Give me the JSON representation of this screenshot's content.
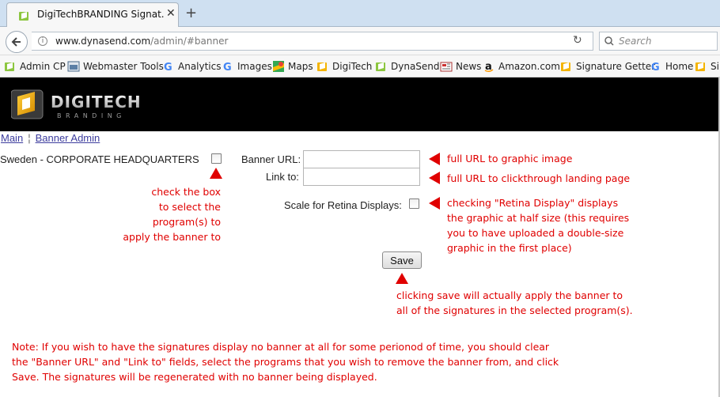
{
  "browser": {
    "tab_title": "DigiTechBRANDING Signat...",
    "url_host": "www.dynasend.com",
    "url_path": "/admin/#banner",
    "search_placeholder": "Search",
    "bookmarks": [
      {
        "label": "Admin CP",
        "icon": "digitech-icon"
      },
      {
        "label": "Webmaster Tools",
        "icon": "webmaster-icon"
      },
      {
        "label": "Analytics",
        "icon": "google-icon"
      },
      {
        "label": "Images",
        "icon": "google-icon"
      },
      {
        "label": "Maps",
        "icon": "maps-icon"
      },
      {
        "label": "DigiTech",
        "icon": "digitech-icon"
      },
      {
        "label": "DynaSend",
        "icon": "digitech-icon"
      },
      {
        "label": "News",
        "icon": "news-icon"
      },
      {
        "label": "Amazon.com",
        "icon": "amazon-icon"
      },
      {
        "label": "Signature Getter",
        "icon": "digitech-icon"
      },
      {
        "label": "Home",
        "icon": "google-icon"
      },
      {
        "label": "Si",
        "icon": "digitech-icon"
      }
    ]
  },
  "logo": {
    "word": "DIGITECH",
    "sub": "BRANDING"
  },
  "breadcrumb": {
    "main": "Main",
    "separator": "¦",
    "current": "Banner Admin"
  },
  "program": {
    "label": "Sweden - CORPORATE HEADQUARTERS"
  },
  "form": {
    "banner_url_label": "Banner URL:",
    "banner_url_value": "",
    "link_to_label": "Link to:",
    "link_to_value": "",
    "retina_label": "Scale for Retina Displays:",
    "save_label": "Save"
  },
  "annotations": {
    "checkbox_note": [
      "check the box",
      "to select the",
      "program(s) to",
      "apply the banner to"
    ],
    "banner_url_note": "full URL to graphic image",
    "link_to_note": "full URL to clickthrough landing page",
    "retina_note": [
      "checking \"Retina Display\" displays",
      "the graphic at half size (this requires",
      "you to have uploaded a double-size",
      "graphic in the first place)"
    ],
    "save_note": [
      "clicking save will actually apply the banner to",
      "all of the signatures in the selected program(s)."
    ],
    "footer_note": [
      "Note: If you wish to have the signatures display no banner at all for some perionod of time, you should clear",
      "the \"Banner URL\" and \"Link to\" fields, select the programs that you wish to remove the banner from, and click",
      "Save. The signatures will be regenerated with no banner being displayed."
    ]
  },
  "colors": {
    "annotation": "#e00000",
    "banner_bg": "#000000",
    "link": "#3d3d9e"
  }
}
